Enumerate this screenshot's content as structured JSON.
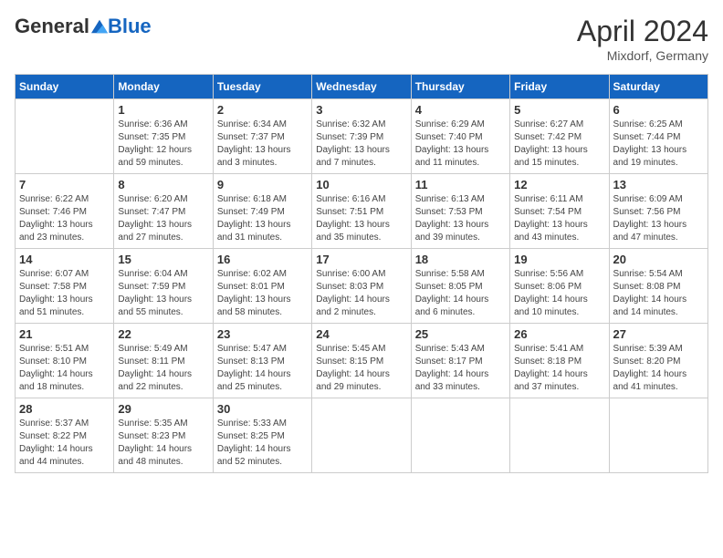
{
  "header": {
    "logo_general": "General",
    "logo_blue": "Blue",
    "month_title": "April 2024",
    "location": "Mixdorf, Germany"
  },
  "calendar": {
    "days_of_week": [
      "Sunday",
      "Monday",
      "Tuesday",
      "Wednesday",
      "Thursday",
      "Friday",
      "Saturday"
    ],
    "weeks": [
      [
        {
          "day": "",
          "sunrise": "",
          "sunset": "",
          "daylight": ""
        },
        {
          "day": "1",
          "sunrise": "Sunrise: 6:36 AM",
          "sunset": "Sunset: 7:35 PM",
          "daylight": "Daylight: 12 hours and 59 minutes."
        },
        {
          "day": "2",
          "sunrise": "Sunrise: 6:34 AM",
          "sunset": "Sunset: 7:37 PM",
          "daylight": "Daylight: 13 hours and 3 minutes."
        },
        {
          "day": "3",
          "sunrise": "Sunrise: 6:32 AM",
          "sunset": "Sunset: 7:39 PM",
          "daylight": "Daylight: 13 hours and 7 minutes."
        },
        {
          "day": "4",
          "sunrise": "Sunrise: 6:29 AM",
          "sunset": "Sunset: 7:40 PM",
          "daylight": "Daylight: 13 hours and 11 minutes."
        },
        {
          "day": "5",
          "sunrise": "Sunrise: 6:27 AM",
          "sunset": "Sunset: 7:42 PM",
          "daylight": "Daylight: 13 hours and 15 minutes."
        },
        {
          "day": "6",
          "sunrise": "Sunrise: 6:25 AM",
          "sunset": "Sunset: 7:44 PM",
          "daylight": "Daylight: 13 hours and 19 minutes."
        }
      ],
      [
        {
          "day": "7",
          "sunrise": "Sunrise: 6:22 AM",
          "sunset": "Sunset: 7:46 PM",
          "daylight": "Daylight: 13 hours and 23 minutes."
        },
        {
          "day": "8",
          "sunrise": "Sunrise: 6:20 AM",
          "sunset": "Sunset: 7:47 PM",
          "daylight": "Daylight: 13 hours and 27 minutes."
        },
        {
          "day": "9",
          "sunrise": "Sunrise: 6:18 AM",
          "sunset": "Sunset: 7:49 PM",
          "daylight": "Daylight: 13 hours and 31 minutes."
        },
        {
          "day": "10",
          "sunrise": "Sunrise: 6:16 AM",
          "sunset": "Sunset: 7:51 PM",
          "daylight": "Daylight: 13 hours and 35 minutes."
        },
        {
          "day": "11",
          "sunrise": "Sunrise: 6:13 AM",
          "sunset": "Sunset: 7:53 PM",
          "daylight": "Daylight: 13 hours and 39 minutes."
        },
        {
          "day": "12",
          "sunrise": "Sunrise: 6:11 AM",
          "sunset": "Sunset: 7:54 PM",
          "daylight": "Daylight: 13 hours and 43 minutes."
        },
        {
          "day": "13",
          "sunrise": "Sunrise: 6:09 AM",
          "sunset": "Sunset: 7:56 PM",
          "daylight": "Daylight: 13 hours and 47 minutes."
        }
      ],
      [
        {
          "day": "14",
          "sunrise": "Sunrise: 6:07 AM",
          "sunset": "Sunset: 7:58 PM",
          "daylight": "Daylight: 13 hours and 51 minutes."
        },
        {
          "day": "15",
          "sunrise": "Sunrise: 6:04 AM",
          "sunset": "Sunset: 7:59 PM",
          "daylight": "Daylight: 13 hours and 55 minutes."
        },
        {
          "day": "16",
          "sunrise": "Sunrise: 6:02 AM",
          "sunset": "Sunset: 8:01 PM",
          "daylight": "Daylight: 13 hours and 58 minutes."
        },
        {
          "day": "17",
          "sunrise": "Sunrise: 6:00 AM",
          "sunset": "Sunset: 8:03 PM",
          "daylight": "Daylight: 14 hours and 2 minutes."
        },
        {
          "day": "18",
          "sunrise": "Sunrise: 5:58 AM",
          "sunset": "Sunset: 8:05 PM",
          "daylight": "Daylight: 14 hours and 6 minutes."
        },
        {
          "day": "19",
          "sunrise": "Sunrise: 5:56 AM",
          "sunset": "Sunset: 8:06 PM",
          "daylight": "Daylight: 14 hours and 10 minutes."
        },
        {
          "day": "20",
          "sunrise": "Sunrise: 5:54 AM",
          "sunset": "Sunset: 8:08 PM",
          "daylight": "Daylight: 14 hours and 14 minutes."
        }
      ],
      [
        {
          "day": "21",
          "sunrise": "Sunrise: 5:51 AM",
          "sunset": "Sunset: 8:10 PM",
          "daylight": "Daylight: 14 hours and 18 minutes."
        },
        {
          "day": "22",
          "sunrise": "Sunrise: 5:49 AM",
          "sunset": "Sunset: 8:11 PM",
          "daylight": "Daylight: 14 hours and 22 minutes."
        },
        {
          "day": "23",
          "sunrise": "Sunrise: 5:47 AM",
          "sunset": "Sunset: 8:13 PM",
          "daylight": "Daylight: 14 hours and 25 minutes."
        },
        {
          "day": "24",
          "sunrise": "Sunrise: 5:45 AM",
          "sunset": "Sunset: 8:15 PM",
          "daylight": "Daylight: 14 hours and 29 minutes."
        },
        {
          "day": "25",
          "sunrise": "Sunrise: 5:43 AM",
          "sunset": "Sunset: 8:17 PM",
          "daylight": "Daylight: 14 hours and 33 minutes."
        },
        {
          "day": "26",
          "sunrise": "Sunrise: 5:41 AM",
          "sunset": "Sunset: 8:18 PM",
          "daylight": "Daylight: 14 hours and 37 minutes."
        },
        {
          "day": "27",
          "sunrise": "Sunrise: 5:39 AM",
          "sunset": "Sunset: 8:20 PM",
          "daylight": "Daylight: 14 hours and 41 minutes."
        }
      ],
      [
        {
          "day": "28",
          "sunrise": "Sunrise: 5:37 AM",
          "sunset": "Sunset: 8:22 PM",
          "daylight": "Daylight: 14 hours and 44 minutes."
        },
        {
          "day": "29",
          "sunrise": "Sunrise: 5:35 AM",
          "sunset": "Sunset: 8:23 PM",
          "daylight": "Daylight: 14 hours and 48 minutes."
        },
        {
          "day": "30",
          "sunrise": "Sunrise: 5:33 AM",
          "sunset": "Sunset: 8:25 PM",
          "daylight": "Daylight: 14 hours and 52 minutes."
        },
        {
          "day": "",
          "sunrise": "",
          "sunset": "",
          "daylight": ""
        },
        {
          "day": "",
          "sunrise": "",
          "sunset": "",
          "daylight": ""
        },
        {
          "day": "",
          "sunrise": "",
          "sunset": "",
          "daylight": ""
        },
        {
          "day": "",
          "sunrise": "",
          "sunset": "",
          "daylight": ""
        }
      ]
    ]
  }
}
